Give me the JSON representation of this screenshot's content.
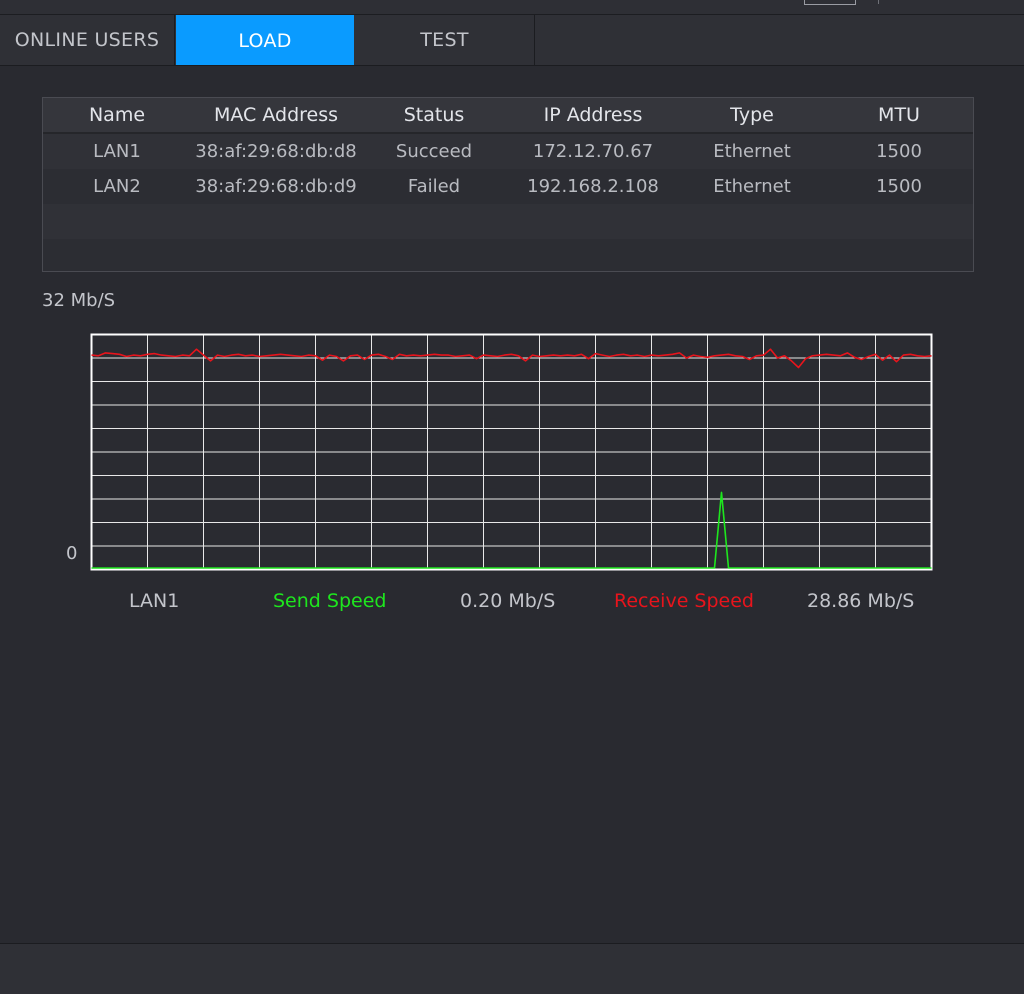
{
  "tabs": [
    {
      "label": "ONLINE USERS",
      "active": false
    },
    {
      "label": "LOAD",
      "active": true
    },
    {
      "label": "TEST",
      "active": false
    }
  ],
  "table": {
    "columns": [
      "Name",
      "MAC Address",
      "Status",
      "IP Address",
      "Type",
      "MTU"
    ],
    "rows": [
      [
        "LAN1",
        "38:af:29:68:db:d8",
        "Succeed",
        "172.12.70.67",
        "Ethernet",
        "1500"
      ],
      [
        "LAN2",
        "38:af:29:68:db:d9",
        "Failed",
        "192.168.2.108",
        "Ethernet",
        "1500"
      ]
    ]
  },
  "chart": {
    "y_max_label": "32 Mb/S",
    "y_min_label": "0",
    "interface": "LAN1",
    "send_label": "Send Speed",
    "send_value": "0.20 Mb/S",
    "receive_label": "Receive Speed",
    "receive_value": "28.86 Mb/S",
    "colors": {
      "send": "#1ee61e",
      "receive": "#e8141c",
      "grid": "#e8e8e8",
      "accent": "#0a9bff"
    }
  },
  "chart_data": {
    "type": "line",
    "title": "",
    "xlabel": "",
    "ylabel": "",
    "ylim": [
      0,
      32
    ],
    "grid": true,
    "legend": "bottom",
    "series": [
      {
        "name": "Receive Speed",
        "values": [
          29.2,
          29.1,
          29.5,
          29.4,
          29.3,
          29.0,
          29.2,
          29.1,
          29.3,
          29.4,
          29.2,
          29.1,
          29.0,
          29.2,
          29.1,
          30.0,
          29.2,
          28.4,
          29.2,
          29.0,
          29.2,
          29.3,
          29.1,
          29.2,
          29.0,
          29.1,
          29.2,
          29.3,
          29.2,
          29.1,
          29.0,
          29.2,
          29.1,
          28.5,
          29.2,
          29.0,
          28.4,
          29.1,
          29.2,
          28.6,
          29.2,
          29.3,
          29.0,
          28.6,
          29.3,
          29.1,
          29.2,
          29.1,
          29.2,
          29.3,
          29.2,
          29.2,
          29.0,
          29.1,
          29.2,
          28.7,
          29.2,
          29.1,
          29.0,
          29.2,
          29.3,
          29.1,
          28.4,
          29.2,
          29.0,
          29.1,
          29.2,
          29.1,
          29.2,
          29.1,
          29.3,
          28.7,
          29.4,
          29.2,
          29.0,
          29.2,
          29.3,
          29.1,
          29.2,
          29.0,
          29.2,
          29.1,
          29.2,
          29.3,
          29.5,
          28.8,
          29.2,
          29.0,
          28.9,
          29.1,
          29.2,
          29.3,
          29.1,
          29.0,
          28.6,
          29.1,
          29.2,
          30.0,
          28.8,
          29.1,
          28.4,
          27.5,
          28.7,
          29.1,
          29.2,
          29.3,
          29.2,
          29.1,
          29.5,
          28.9,
          28.6,
          29.0,
          29.3,
          28.5,
          29.2,
          28.3,
          29.2,
          29.3,
          29.1,
          29.0,
          29.1
        ]
      },
      {
        "name": "Send Speed",
        "values": [
          0.2,
          0.2,
          0.2,
          0.2,
          0.2,
          0.2,
          0.2,
          0.2,
          0.2,
          0.2,
          0.2,
          0.2,
          0.2,
          0.2,
          0.2,
          0.2,
          0.2,
          0.2,
          0.2,
          0.2,
          0.2,
          0.2,
          0.2,
          0.2,
          0.2,
          0.2,
          0.2,
          0.2,
          0.2,
          0.2,
          0.2,
          0.2,
          0.2,
          0.2,
          0.2,
          0.2,
          0.2,
          0.2,
          0.2,
          0.2,
          0.2,
          0.2,
          0.2,
          0.2,
          0.2,
          0.2,
          0.2,
          0.2,
          0.2,
          0.2,
          0.2,
          0.2,
          0.2,
          0.2,
          0.2,
          0.2,
          0.2,
          0.2,
          0.2,
          0.2,
          0.2,
          0.2,
          0.2,
          0.2,
          0.2,
          0.2,
          0.2,
          0.2,
          0.2,
          0.2,
          0.2,
          0.2,
          0.2,
          0.2,
          0.2,
          0.2,
          0.2,
          0.2,
          0.2,
          0.2,
          0.2,
          0.2,
          0.2,
          0.2,
          0.2,
          0.2,
          0.2,
          0.2,
          0.2,
          0.2,
          10.5,
          0.2,
          0.2,
          0.2,
          0.2,
          0.2,
          0.2,
          0.2,
          0.2,
          0.2,
          0.2,
          0.2,
          0.2,
          0.2,
          0.2,
          0.2,
          0.2,
          0.2,
          0.2,
          0.2,
          0.2,
          0.2,
          0.2,
          0.2,
          0.2,
          0.2,
          0.2,
          0.2,
          0.2,
          0.2,
          0.2
        ]
      }
    ]
  }
}
